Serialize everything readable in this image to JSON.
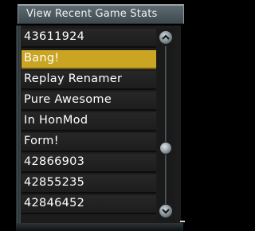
{
  "header": {
    "title": "View Recent Game Stats"
  },
  "list": {
    "items": [
      {
        "label": "43611924",
        "selected": false
      },
      {
        "label": "Bang!",
        "selected": true
      },
      {
        "label": "Replay Renamer",
        "selected": false
      },
      {
        "label": "Pure Awesome",
        "selected": false
      },
      {
        "label": "In HonMod",
        "selected": false
      },
      {
        "label": "Form!",
        "selected": false
      },
      {
        "label": "42866903",
        "selected": false
      },
      {
        "label": "42855235",
        "selected": false
      },
      {
        "label": "42846452",
        "selected": false
      }
    ]
  },
  "scrollbar": {
    "up_icon": "chevron-up-icon",
    "down_icon": "chevron-down-icon",
    "position": 0.8
  },
  "colors": {
    "selected_row": "#c9a523",
    "row_text": "#ffffff",
    "header_bg": "#4e5b61"
  }
}
